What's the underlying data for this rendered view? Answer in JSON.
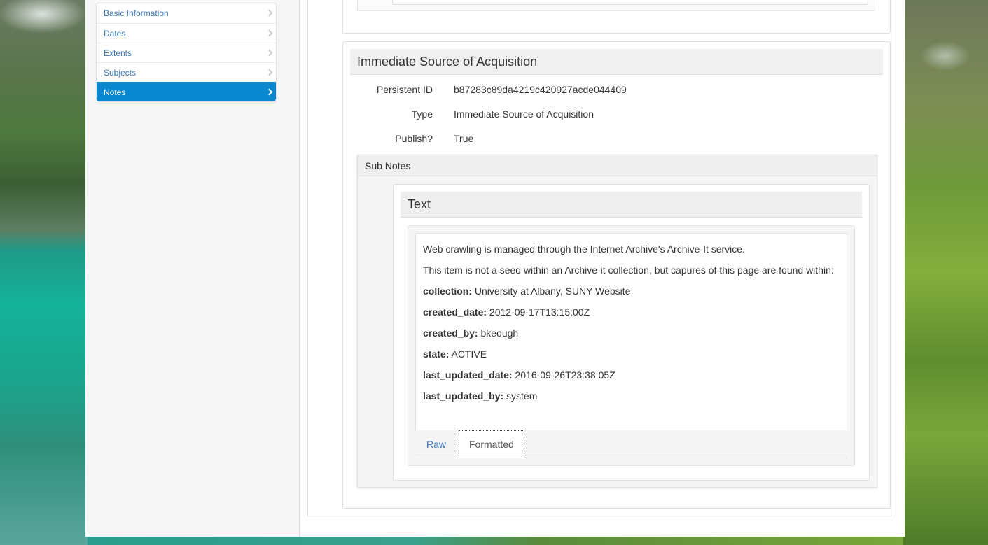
{
  "sidebar": {
    "items": [
      {
        "label": "Basic Information"
      },
      {
        "label": "Dates"
      },
      {
        "label": "Extents"
      },
      {
        "label": "Subjects"
      },
      {
        "label": "Notes"
      }
    ],
    "active": "Notes"
  },
  "note": {
    "title": "Immediate Source of Acquisition",
    "fields": [
      {
        "label": "Persistent ID",
        "value": "b87283c89da4219c420927acde044409"
      },
      {
        "label": "Type",
        "value": "Immediate Source of Acquisition"
      },
      {
        "label": "Publish?",
        "value": "True"
      }
    ],
    "subnotes_label": "Sub Notes",
    "subnote": {
      "title": "Text",
      "intro": "Web crawling is managed through the Internet Archive's Archive-It service.",
      "intro2": "This item is not a seed within an Archive-it collection, but capures of this page are found within:",
      "props": [
        {
          "key": "collection:",
          "value": " University at Albany, SUNY Website"
        },
        {
          "key": "created_date:",
          "value": " 2012-09-17T13:15:00Z"
        },
        {
          "key": "created_by:",
          "value": " bkeough"
        },
        {
          "key": "state:",
          "value": " ACTIVE"
        },
        {
          "key": "last_updated_date:",
          "value": " 2016-09-26T23:38:05Z"
        },
        {
          "key": "last_updated_by:",
          "value": " system"
        }
      ],
      "tabs": {
        "raw": "Raw",
        "formatted": "Formatted"
      },
      "active_tab": "Formatted"
    }
  },
  "colors": {
    "accent": "#0a88cf",
    "link": "#3a78b8"
  }
}
